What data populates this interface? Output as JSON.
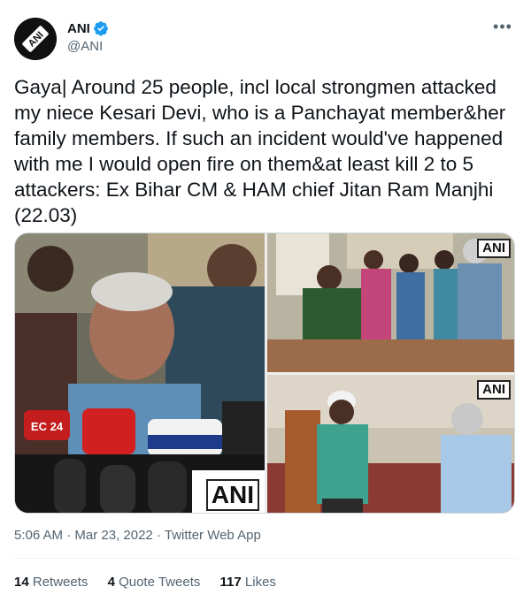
{
  "author": {
    "display_name": "ANI",
    "handle": "@ANI",
    "avatar_text": "ANI",
    "verified": true
  },
  "tweet": {
    "text": "Gaya| Around 25 people, incl local strongmen attacked my niece Kesari Devi, who is a Panchayat member&her family members. If such an incident would've happened with me I would open fire on them&at least kill 2 to 5 attackers: Ex Bihar CM & HAM chief Jitan Ram Manjhi  (22.03)",
    "photo_watermark": "ANI",
    "time": "5:06 AM",
    "date": "Mar 23, 2022",
    "separator": "·",
    "source": "Twitter Web App"
  },
  "stats": {
    "retweets_count": "14",
    "retweets_label": "Retweets",
    "quotes_count": "4",
    "quotes_label": "Quote Tweets",
    "likes_count": "117",
    "likes_label": "Likes"
  },
  "icons": {
    "more": "more-icon",
    "verified": "verified-badge-icon"
  },
  "colors": {
    "text": "#0f1419",
    "secondary": "#536471",
    "verified": "#1d9bf0",
    "border": "#cfd9de"
  }
}
